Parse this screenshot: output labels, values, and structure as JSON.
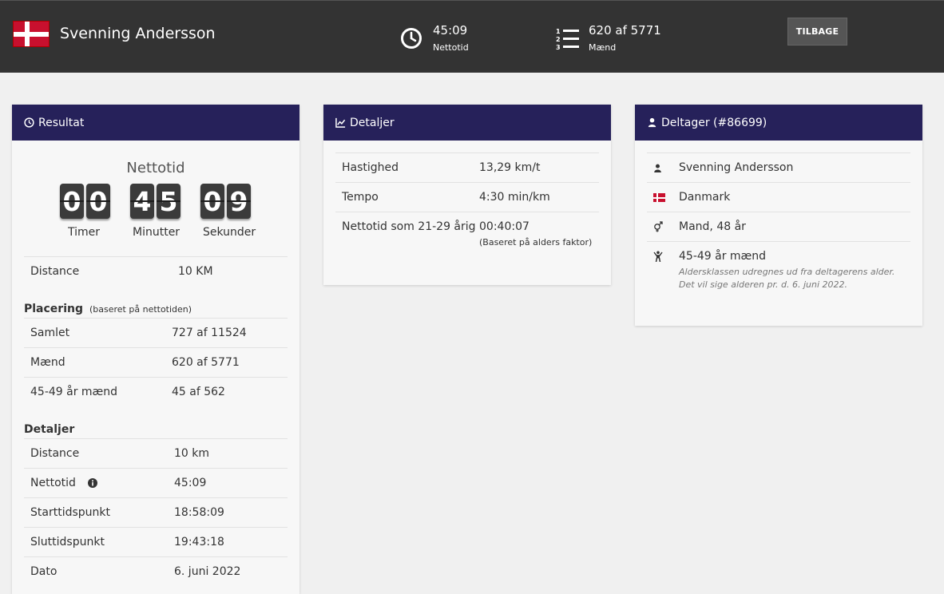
{
  "header": {
    "name": "Svenning Andersson",
    "net_time": "45:09",
    "net_time_label": "Nettotid",
    "placement": "620 af 5771",
    "placement_label": "Mænd",
    "back_button": "TILBAGE",
    "flag_icon": "denmark-flag-icon"
  },
  "colors": {
    "header_bg": "#333333",
    "card_header": "#26215a",
    "page_bg": "#f0f0f0"
  },
  "result": {
    "title": "Resultat",
    "net_label": "Nettotid",
    "hours": [
      "0",
      "0"
    ],
    "minutes": [
      "4",
      "5"
    ],
    "seconds": [
      "0",
      "9"
    ],
    "hours_label": "Timer",
    "minutes_label": "Minutter",
    "seconds_label": "Sekunder",
    "distance_label": "Distance",
    "distance_value": "10 KM",
    "placement_title": "Placering",
    "placement_sub": "(baseret på nettotiden)",
    "placements": [
      {
        "label": "Samlet",
        "value": "727 af 11524"
      },
      {
        "label": "Mænd",
        "value": "620 af 5771"
      },
      {
        "label": "45-49 år mænd",
        "value": "45 af 562"
      }
    ],
    "details_title": "Detaljer",
    "details": [
      {
        "label": "Distance",
        "value": "10 km"
      },
      {
        "label": "Nettotid",
        "value": "45:09"
      },
      {
        "label": "Starttidspunkt",
        "value": "18:58:09"
      },
      {
        "label": "Sluttidspunkt",
        "value": "19:43:18"
      },
      {
        "label": "Dato",
        "value": "6. juni 2022"
      }
    ]
  },
  "details_card": {
    "title": "Detaljer",
    "rows": [
      {
        "label": "Hastighed",
        "value": "13,29 km/t"
      },
      {
        "label": "Tempo",
        "value": "4:30 min/km"
      },
      {
        "label": "Nettotid som 21-29 årig",
        "value": "00:40:07",
        "note": "(Baseret på alders faktor)"
      }
    ]
  },
  "participant": {
    "title": "Deltager (#86699)",
    "name": "Svenning Andersson",
    "country": "Danmark",
    "gender_age": "Mand, 48 år",
    "age_class": "45-49 år mænd",
    "age_class_note": "Aldersklassen udregnes ud fra deltagerens alder. Det vil sige alderen pr. d. 6. juni 2022."
  }
}
